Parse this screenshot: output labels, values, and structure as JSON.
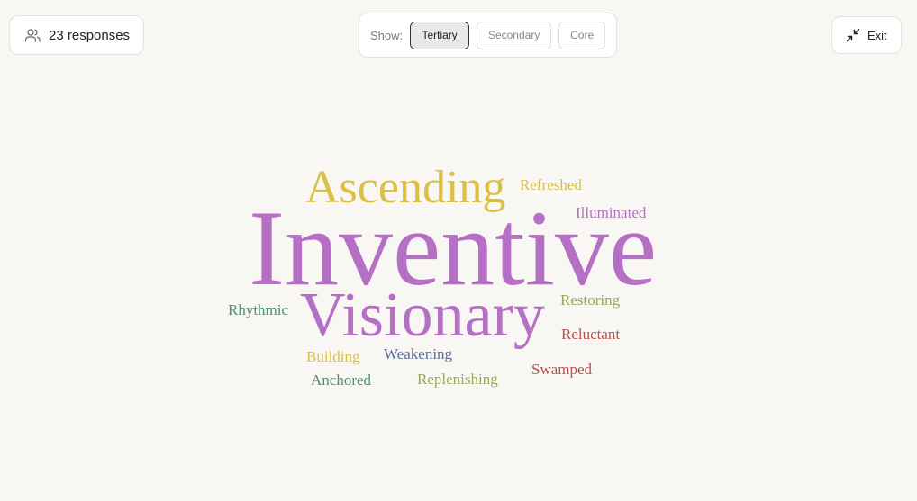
{
  "header": {
    "responses_label": "23 responses",
    "responses_icon": "users-icon"
  },
  "filter": {
    "show_label": "Show:",
    "options": [
      {
        "label": "Tertiary",
        "selected": true
      },
      {
        "label": "Secondary",
        "selected": false
      },
      {
        "label": "Core",
        "selected": false
      }
    ]
  },
  "exit": {
    "label": "Exit",
    "icon": "minimize-icon"
  },
  "colors": {
    "purple": "#b56fc4",
    "gold": "#dcbf45",
    "green": "#4f9172",
    "olive": "#96aa56",
    "red": "#b35151",
    "slate": "#5e6c9b"
  },
  "words": [
    {
      "text": "Inventive",
      "color": "#b56fc4"
    },
    {
      "text": "Visionary",
      "color": "#b56fc4"
    },
    {
      "text": "Ascending",
      "color": "#dcbf45"
    },
    {
      "text": "Refreshed",
      "color": "#dcbf45"
    },
    {
      "text": "Illuminated",
      "color": "#b56fc4"
    },
    {
      "text": "Restoring",
      "color": "#96aa56"
    },
    {
      "text": "Rhythmic",
      "color": "#4f9172"
    },
    {
      "text": "Reluctant",
      "color": "#b35151"
    },
    {
      "text": "Building",
      "color": "#dcbf45"
    },
    {
      "text": "Weakening",
      "color": "#5e6c9b"
    },
    {
      "text": "Swamped",
      "color": "#b35151"
    },
    {
      "text": "Anchored",
      "color": "#4f9172"
    },
    {
      "text": "Replenishing",
      "color": "#96aa56"
    }
  ]
}
